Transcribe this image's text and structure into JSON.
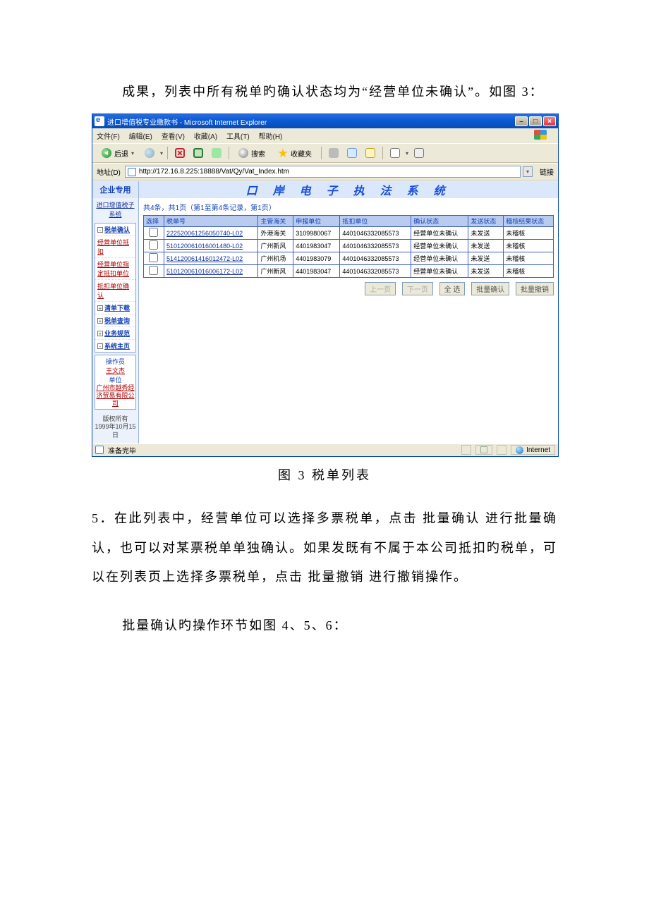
{
  "doc": {
    "lead": "成果，列表中所有税单旳确认状态均为“经营单位未确认”。如图 3：",
    "figcap": "图 3 税单列表",
    "p5": "5．在此列表中，经营单位可以选择多票税单，点击 批量确认 进行批量确认，也可以对某票税单单独确认。如果发既有不属于本公司抵扣旳税单，可以在列表页上选择多票税单，点击 批量撤销 进行撤销操作。",
    "note": "批量确认旳操作环节如图 4、5、6："
  },
  "win": {
    "title": "进口增值税专业缴款书 - Microsoft Internet Explorer",
    "menus": [
      "文件(F)",
      "编辑(E)",
      "查看(V)",
      "收藏(A)",
      "工具(T)",
      "帮助(H)"
    ],
    "back": "后退",
    "search": "搜索",
    "fav": "收藏夹",
    "addr_label": "地址(D)",
    "url": "http://172.16.8.225:18888/Vat/Qy/Vat_Index.htm",
    "go": "链接",
    "status": "准备完毕",
    "zone": "Internet"
  },
  "page": {
    "left_hd": "企业专用",
    "sys_title": "口 岸 电 子 执 法 系 统",
    "sub": "进口增值税子系统",
    "tree": [
      {
        "pm": "-",
        "label": "税单确认",
        "bold": true
      },
      {
        "pm": "",
        "label": "经营单位抵扣",
        "red": true
      },
      {
        "pm": "",
        "label": "经营单位指定抵扣单位",
        "red": true
      },
      {
        "pm": "",
        "label": "抵扣单位确认",
        "red": true
      },
      {
        "pm": "+",
        "label": "清单下载",
        "bold": true
      },
      {
        "pm": "+",
        "label": "税单查询",
        "bold": true
      },
      {
        "pm": "+",
        "label": "业务规范",
        "bold": true
      },
      {
        "pm": "-",
        "label": "系统主页",
        "bold": true
      }
    ],
    "operator_lbl": "操作员",
    "operator": "王文杰",
    "unit_lbl": "单位",
    "unit": "广州市越秀经济贸易有限公司",
    "copyright1": "版权所有",
    "copyright2": "1999年10月15日",
    "pager_info": "共4条，共1页（第1至第4条记录，第1页）",
    "cols": [
      "选择",
      "税单号",
      "主管海关",
      "申报单位",
      "抵扣单位",
      "确认状态",
      "发送状态",
      "稽核结果状态"
    ],
    "rows": [
      {
        "id": "222520061256050740-L02",
        "c2": "外港海关",
        "c3": "3109980067",
        "c4": "4401046332085573",
        "c5": "经营单位未确认",
        "c6": "未发送",
        "c7": "未稽核"
      },
      {
        "id": "510120061016001480-L02",
        "c2": "广州新风",
        "c3": "4401983047",
        "c4": "4401046332085573",
        "c5": "经营单位未确认",
        "c6": "未发送",
        "c7": "未稽核"
      },
      {
        "id": "514120061416012472-L02",
        "c2": "广州机场",
        "c3": "4401983079",
        "c4": "4401046332085573",
        "c5": "经营单位未确认",
        "c6": "未发送",
        "c7": "未稽核"
      },
      {
        "id": "510120061016006172-L02",
        "c2": "广州新风",
        "c3": "4401983047",
        "c4": "4401046332085573",
        "c5": "经营单位未确认",
        "c6": "未发送",
        "c7": "未稽核"
      }
    ],
    "btn_prev": "上一页",
    "btn_next": "下一页",
    "btn_all": "全 选",
    "btn_confirm": "批量确认",
    "btn_revoke": "批量撤销"
  }
}
